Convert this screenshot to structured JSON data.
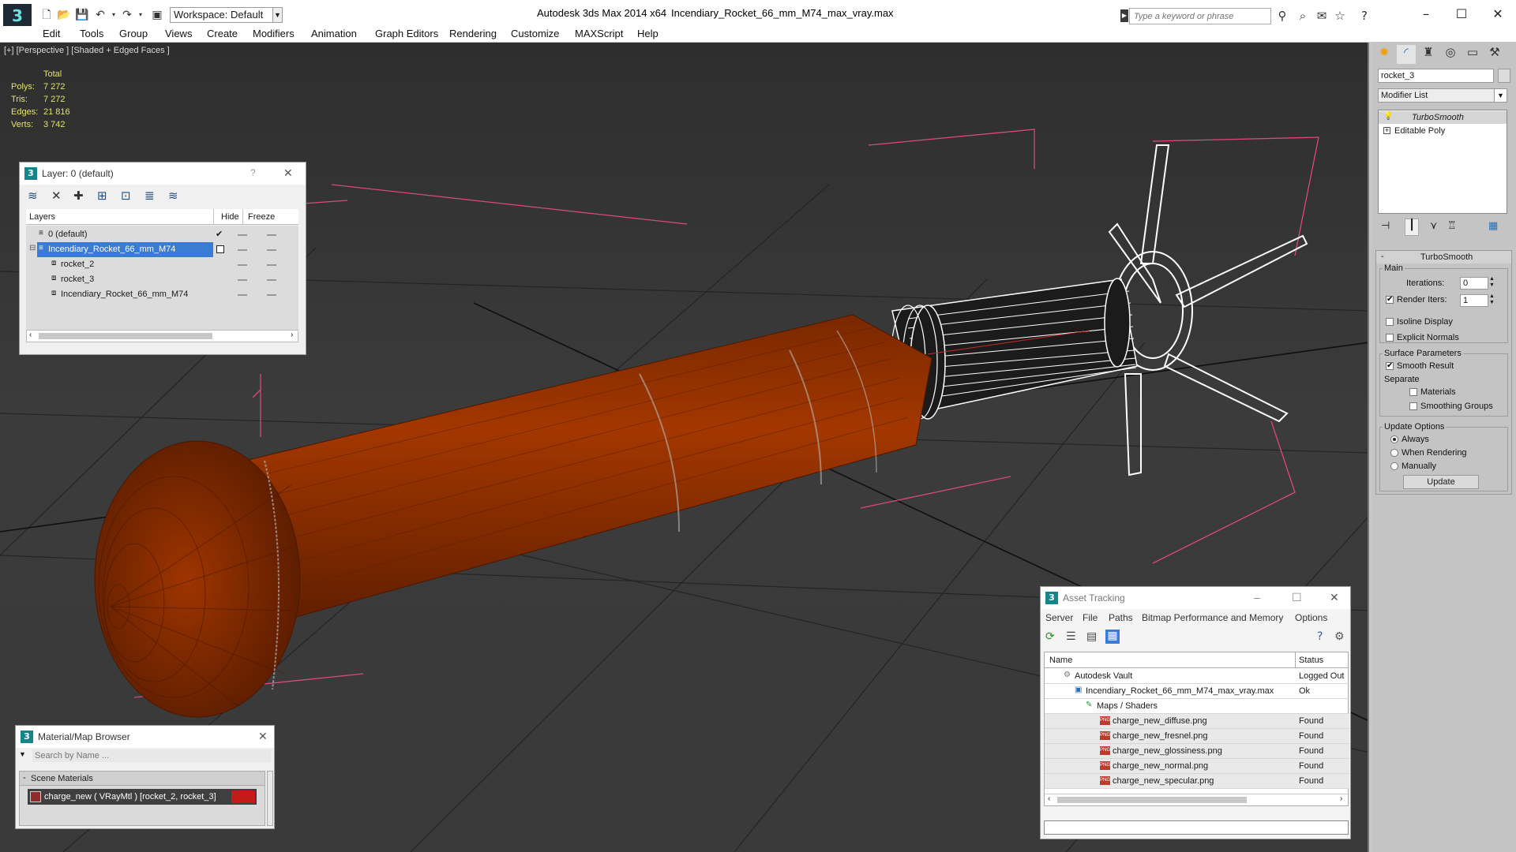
{
  "titlebar": {
    "logo": "3",
    "workspace": "Workspace: Default",
    "app_title": "Autodesk 3ds Max  2014 x64",
    "doc_title": "Incendiary_Rocket_66_mm_M74_max_vray.max",
    "search_placeholder": "Type a keyword or phrase",
    "minimize": "–",
    "maximize": "☐",
    "close": "✕"
  },
  "menu": [
    "Edit",
    "Tools",
    "Group",
    "Views",
    "Create",
    "Modifiers",
    "Animation",
    "Graph Editors",
    "Rendering",
    "Customize",
    "MAXScript",
    "Help"
  ],
  "viewport": {
    "label": "[+] [Perspective ] [Shaded + Edged Faces ]",
    "stats": {
      "header": "Total",
      "rows": [
        {
          "label": "Polys:",
          "value": "7 272"
        },
        {
          "label": "Tris:",
          "value": "7 272"
        },
        {
          "label": "Edges:",
          "value": "21 816"
        },
        {
          "label": "Verts:",
          "value": "3 742"
        }
      ]
    }
  },
  "layer_panel": {
    "title": "Layer: 0 (default)",
    "help": "?",
    "close": "✕",
    "columns": {
      "layers": "Layers",
      "hide": "Hide",
      "freeze": "Freeze"
    },
    "rows": [
      {
        "name": "0 (default)",
        "indent": 0,
        "selected": false,
        "check": "✔"
      },
      {
        "name": "Incendiary_Rocket_66_mm_M74",
        "indent": 0,
        "selected": true,
        "check": ""
      },
      {
        "name": "rocket_2",
        "indent": 1,
        "selected": false,
        "check": ""
      },
      {
        "name": "rocket_3",
        "indent": 1,
        "selected": false,
        "check": ""
      },
      {
        "name": "Incendiary_Rocket_66_mm_M74",
        "indent": 1,
        "selected": false,
        "check": ""
      }
    ]
  },
  "material_browser": {
    "title": "Material/Map Browser",
    "close": "✕",
    "search_placeholder": "Search by Name ...",
    "section": "Scene Materials",
    "collapse": "-",
    "material": "charge_new  ( VRayMtl )  [rocket_2, rocket_3]",
    "swatch_color": "#c41a1a"
  },
  "asset_tracking": {
    "title": "Asset Tracking",
    "minimize": "–",
    "maximize": "☐",
    "close": "✕",
    "menu": [
      "Server",
      "File",
      "Paths",
      "Bitmap Performance and Memory",
      "Options"
    ],
    "columns": {
      "name": "Name",
      "status": "Status"
    },
    "rows": [
      {
        "name": "Autodesk Vault",
        "status": "Logged Out",
        "indent": 0,
        "icon": "vault-icon"
      },
      {
        "name": "Incendiary_Rocket_66_mm_M74_max_vray.max",
        "status": "Ok",
        "indent": 1,
        "icon": "max-file-icon"
      },
      {
        "name": "Maps / Shaders",
        "status": "",
        "indent": 2,
        "icon": "maps-folder-icon"
      },
      {
        "name": "charge_new_diffuse.png",
        "status": "Found",
        "indent": 3,
        "icon": "png-icon"
      },
      {
        "name": "charge_new_fresnel.png",
        "status": "Found",
        "indent": 3,
        "icon": "png-icon"
      },
      {
        "name": "charge_new_glossiness.png",
        "status": "Found",
        "indent": 3,
        "icon": "png-icon"
      },
      {
        "name": "charge_new_normal.png",
        "status": "Found",
        "indent": 3,
        "icon": "png-icon"
      },
      {
        "name": "charge_new_specular.png",
        "status": "Found",
        "indent": 3,
        "icon": "png-icon"
      }
    ]
  },
  "command_panel": {
    "object_name": "rocket_3",
    "modifier_list": "Modifier List",
    "stack": [
      {
        "name": "TurboSmooth",
        "active": true
      },
      {
        "name": "Editable Poly",
        "active": false
      }
    ],
    "rollout_title": "TurboSmooth",
    "main_label": "Main",
    "iterations_label": "Iterations:",
    "iterations": "0",
    "render_iters_label": "Render Iters:",
    "render_iters": "1",
    "render_iters_checked": true,
    "isoline_label": "Isoline Display",
    "explicit_normals_label": "Explicit Normals",
    "surface_params_label": "Surface Parameters",
    "smooth_result_label": "Smooth Result",
    "smooth_result_checked": true,
    "separate_label": "Separate",
    "materials_label": "Materials",
    "smoothing_groups_label": "Smoothing Groups",
    "update_options_label": "Update Options",
    "always_label": "Always",
    "when_rendering_label": "When Rendering",
    "manually_label": "Manually",
    "update_button": "Update",
    "selected_update_option": "Always"
  },
  "colors": {
    "rocket_body": "#9a3200",
    "selection_blue": "#3a7bd5",
    "bbox_pink": "#d94a7a",
    "stats_yellow": "#e3e36a"
  }
}
